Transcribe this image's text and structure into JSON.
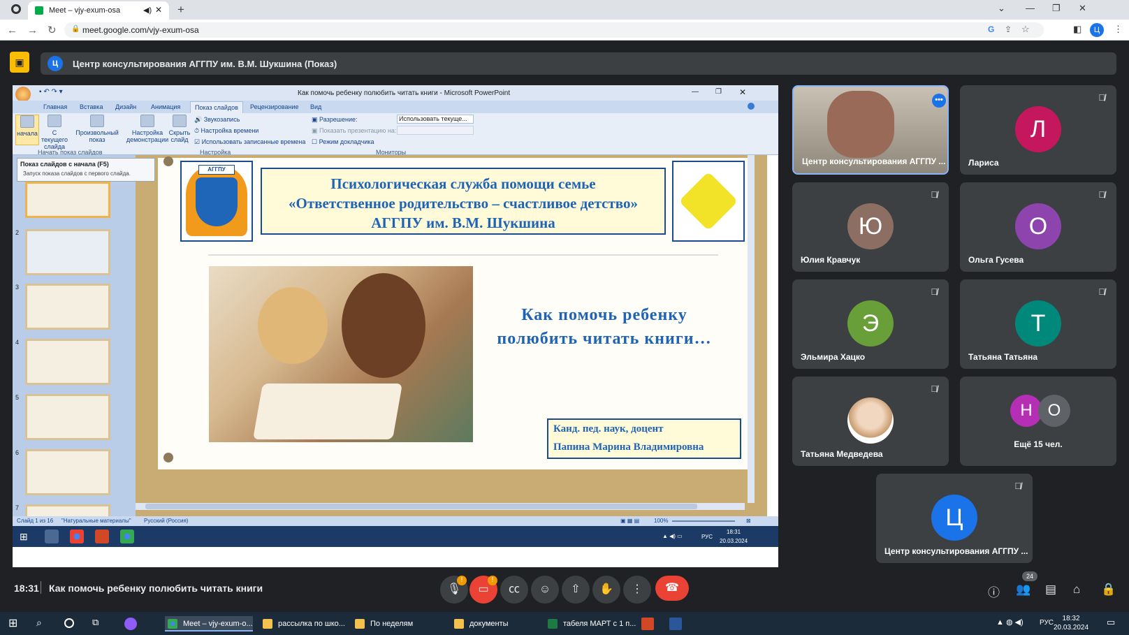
{
  "browser": {
    "tab_title": "Meet – vjy-exum-osa",
    "url": "meet.google.com/vjy-exum-osa",
    "profile_initial": "Ц"
  },
  "meet": {
    "presenter_banner": "Центр консультирования АГГПУ им. В.М. Шукшина (Показ)",
    "presenter_initial": "Ц",
    "time": "18:31",
    "meeting_title": "Как помочь ребенку полюбить читать книги",
    "participant_count": "24"
  },
  "powerpoint": {
    "window_title": "Как помочь ребенку полюбить читать книги - Microsoft PowerPoint",
    "tabs": [
      "Главная",
      "Вставка",
      "Дизайн",
      "Анимация",
      "Показ слайдов",
      "Рецензирование",
      "Вид"
    ],
    "ribbon": {
      "from_start": "начала",
      "from_current": "С текущего слайда",
      "custom_show": "Произвольный показ",
      "setup_show": "Настройка демонстрации",
      "hide_slide": "Скрыть слайд",
      "record_narration": "Звукозапись",
      "rehearse_timings": "Настройка времени",
      "use_timings": "Использовать записанные времена",
      "resolution_label": "Разрешение:",
      "resolution_value": "Использовать текуще...",
      "show_on_label": "Показать презентацию на:",
      "presenter_view": "Режим докладчика",
      "group_start": "Начать показ слайдов",
      "group_setup": "Настройка",
      "group_monitors": "Мониторы"
    },
    "tooltip_title": "Показ слайдов с начала (F5)",
    "tooltip_text": "Запуск показа слайдов с первого слайда.",
    "thumb_numbers": [
      "2",
      "3",
      "4",
      "5",
      "6",
      "7"
    ],
    "slide": {
      "logo_text": "АГГПУ",
      "title_line1": "Психологическая служба помощи семье",
      "title_line2": "«Ответственное родительство – счастливое детство»",
      "title_line3": "АГГПУ им. В.М. Шукшина",
      "subtitle_line1": "Как помочь ребенку",
      "subtitle_line2": "полюбить читать книги…",
      "author_line1": "Канд. пед. наук, доцент",
      "author_line2": "Папина Марина Владимировна"
    },
    "status": {
      "slide_of": "Слайд 1 из 16",
      "theme": "\"Натуральные материалы\"",
      "language": "Русский (Россия)",
      "zoom": "100%"
    },
    "inner_taskbar": {
      "lang": "РУС",
      "time": "18:31",
      "date": "20.03.2024"
    }
  },
  "participants": [
    {
      "name": "Центр консультирования АГГПУ ...",
      "initial": "",
      "color": "#7a6a5a"
    },
    {
      "name": "Лариса",
      "initial": "Л",
      "color": "#c5175e"
    },
    {
      "name": "Юлия Кравчук",
      "initial": "Ю",
      "color": "#8d6e63"
    },
    {
      "name": "Ольга Гусева",
      "initial": "О",
      "color": "#8e44ad"
    },
    {
      "name": "Эльмира Хацко",
      "initial": "Э",
      "color": "#689f38"
    },
    {
      "name": "Татьяна Татьяна",
      "initial": "Т",
      "color": "#00897b"
    },
    {
      "name": "Татьяна Медведева",
      "initial": "",
      "color": "#e7c9a9"
    },
    {
      "name": "Ещё 15 чел.",
      "initial1": "Н",
      "initial2": "О"
    },
    {
      "name": "Центр консультирования АГГПУ ...",
      "initial": "Ц",
      "color": "#1a73e8"
    }
  ],
  "taskbar": {
    "items": [
      "Meet – vjy-exum-o...",
      "рассылка по шко...",
      "По неделям",
      "документы",
      "табеля МАРТ с 1 п..."
    ],
    "lang": "РУС",
    "time": "18:32",
    "date": "20.03.2024"
  }
}
